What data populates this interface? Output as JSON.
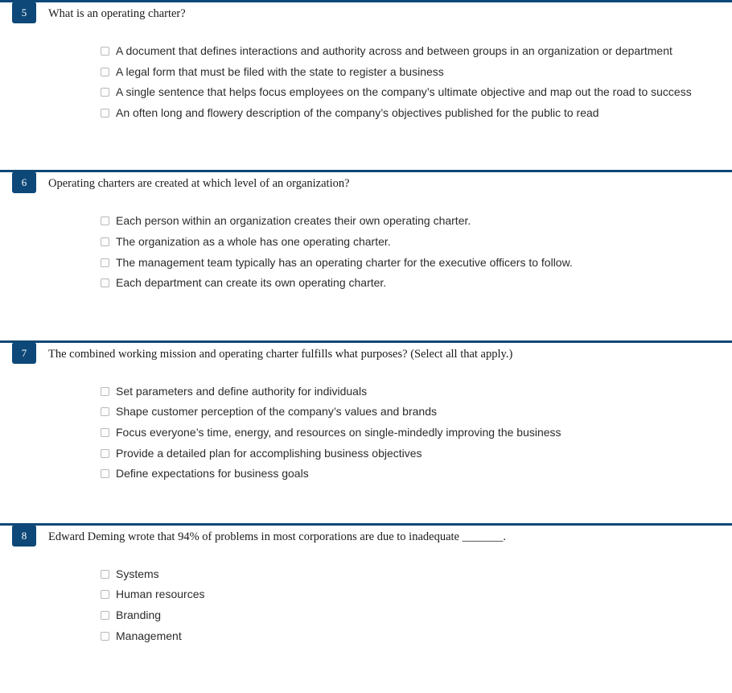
{
  "theme": {
    "accent": "#0d4878",
    "background": "#ffffff",
    "question_text_color": "#1b1b1b",
    "answer_text_color": "#2b2b2b",
    "checkbox_border": "#b9b9b9"
  },
  "questions": [
    {
      "number": "5",
      "text": "What is an operating charter?",
      "answers": [
        "A document that defines interactions and authority across and between groups in an organization or department",
        "A legal form that must be filed with the state to register a business",
        "A single sentence that helps focus employees on the company’s ultimate objective and map out the road to success",
        "An often long and flowery description of the company’s objectives published for the public to read"
      ]
    },
    {
      "number": "6",
      "text": "Operating charters are created at which level of an organization?",
      "answers": [
        "Each person within an organization creates their own operating charter.",
        "The organization as a whole has one operating charter.",
        "The management team typically has an operating charter for the executive officers to follow.",
        "Each department can create its own operating charter."
      ]
    },
    {
      "number": "7",
      "text": "The combined working mission and operating charter fulfills what purposes? (Select all that apply.)",
      "answers": [
        "Set parameters and define authority for individuals",
        "Shape customer perception of the company’s values and brands",
        "Focus everyone’s time, energy, and resources on single-mindedly improving the business",
        "Provide a detailed plan for accomplishing business objectives",
        "Define expectations for business goals"
      ]
    },
    {
      "number": "8",
      "text": "Edward Deming wrote that 94% of problems in most corporations are due to inadequate _______.",
      "answers": [
        "Systems",
        "Human resources",
        "Branding",
        "Management"
      ]
    }
  ]
}
